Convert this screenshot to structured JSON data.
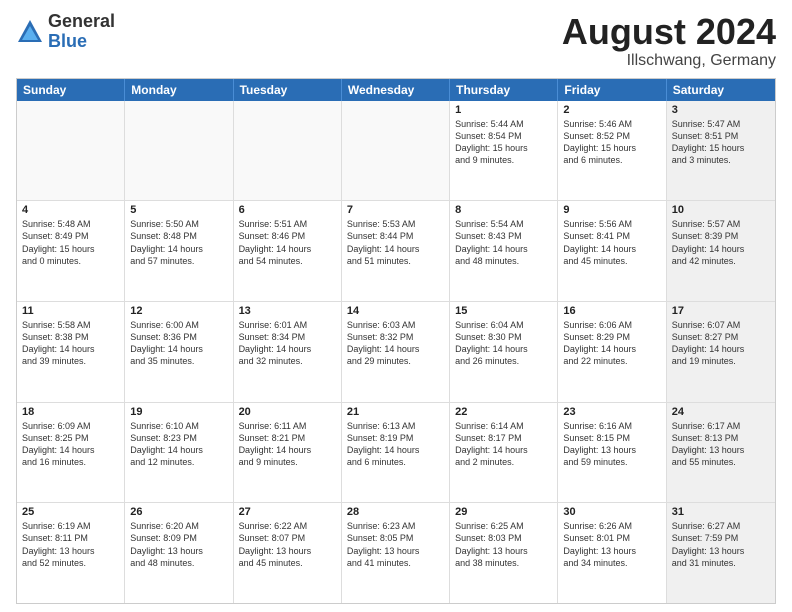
{
  "logo": {
    "general": "General",
    "blue": "Blue"
  },
  "title": {
    "month": "August 2024",
    "location": "Illschwang, Germany"
  },
  "calendar": {
    "headers": [
      "Sunday",
      "Monday",
      "Tuesday",
      "Wednesday",
      "Thursday",
      "Friday",
      "Saturday"
    ],
    "rows": [
      [
        {
          "day": "",
          "empty": true
        },
        {
          "day": "",
          "empty": true
        },
        {
          "day": "",
          "empty": true
        },
        {
          "day": "",
          "empty": true
        },
        {
          "day": "1",
          "info": "Sunrise: 5:44 AM\nSunset: 8:54 PM\nDaylight: 15 hours\nand 9 minutes."
        },
        {
          "day": "2",
          "info": "Sunrise: 5:46 AM\nSunset: 8:52 PM\nDaylight: 15 hours\nand 6 minutes."
        },
        {
          "day": "3",
          "info": "Sunrise: 5:47 AM\nSunset: 8:51 PM\nDaylight: 15 hours\nand 3 minutes.",
          "shaded": true
        }
      ],
      [
        {
          "day": "4",
          "info": "Sunrise: 5:48 AM\nSunset: 8:49 PM\nDaylight: 15 hours\nand 0 minutes."
        },
        {
          "day": "5",
          "info": "Sunrise: 5:50 AM\nSunset: 8:48 PM\nDaylight: 14 hours\nand 57 minutes."
        },
        {
          "day": "6",
          "info": "Sunrise: 5:51 AM\nSunset: 8:46 PM\nDaylight: 14 hours\nand 54 minutes."
        },
        {
          "day": "7",
          "info": "Sunrise: 5:53 AM\nSunset: 8:44 PM\nDaylight: 14 hours\nand 51 minutes."
        },
        {
          "day": "8",
          "info": "Sunrise: 5:54 AM\nSunset: 8:43 PM\nDaylight: 14 hours\nand 48 minutes."
        },
        {
          "day": "9",
          "info": "Sunrise: 5:56 AM\nSunset: 8:41 PM\nDaylight: 14 hours\nand 45 minutes."
        },
        {
          "day": "10",
          "info": "Sunrise: 5:57 AM\nSunset: 8:39 PM\nDaylight: 14 hours\nand 42 minutes.",
          "shaded": true
        }
      ],
      [
        {
          "day": "11",
          "info": "Sunrise: 5:58 AM\nSunset: 8:38 PM\nDaylight: 14 hours\nand 39 minutes."
        },
        {
          "day": "12",
          "info": "Sunrise: 6:00 AM\nSunset: 8:36 PM\nDaylight: 14 hours\nand 35 minutes."
        },
        {
          "day": "13",
          "info": "Sunrise: 6:01 AM\nSunset: 8:34 PM\nDaylight: 14 hours\nand 32 minutes."
        },
        {
          "day": "14",
          "info": "Sunrise: 6:03 AM\nSunset: 8:32 PM\nDaylight: 14 hours\nand 29 minutes."
        },
        {
          "day": "15",
          "info": "Sunrise: 6:04 AM\nSunset: 8:30 PM\nDaylight: 14 hours\nand 26 minutes."
        },
        {
          "day": "16",
          "info": "Sunrise: 6:06 AM\nSunset: 8:29 PM\nDaylight: 14 hours\nand 22 minutes."
        },
        {
          "day": "17",
          "info": "Sunrise: 6:07 AM\nSunset: 8:27 PM\nDaylight: 14 hours\nand 19 minutes.",
          "shaded": true
        }
      ],
      [
        {
          "day": "18",
          "info": "Sunrise: 6:09 AM\nSunset: 8:25 PM\nDaylight: 14 hours\nand 16 minutes."
        },
        {
          "day": "19",
          "info": "Sunrise: 6:10 AM\nSunset: 8:23 PM\nDaylight: 14 hours\nand 12 minutes."
        },
        {
          "day": "20",
          "info": "Sunrise: 6:11 AM\nSunset: 8:21 PM\nDaylight: 14 hours\nand 9 minutes."
        },
        {
          "day": "21",
          "info": "Sunrise: 6:13 AM\nSunset: 8:19 PM\nDaylight: 14 hours\nand 6 minutes."
        },
        {
          "day": "22",
          "info": "Sunrise: 6:14 AM\nSunset: 8:17 PM\nDaylight: 14 hours\nand 2 minutes."
        },
        {
          "day": "23",
          "info": "Sunrise: 6:16 AM\nSunset: 8:15 PM\nDaylight: 13 hours\nand 59 minutes."
        },
        {
          "day": "24",
          "info": "Sunrise: 6:17 AM\nSunset: 8:13 PM\nDaylight: 13 hours\nand 55 minutes.",
          "shaded": true
        }
      ],
      [
        {
          "day": "25",
          "info": "Sunrise: 6:19 AM\nSunset: 8:11 PM\nDaylight: 13 hours\nand 52 minutes."
        },
        {
          "day": "26",
          "info": "Sunrise: 6:20 AM\nSunset: 8:09 PM\nDaylight: 13 hours\nand 48 minutes."
        },
        {
          "day": "27",
          "info": "Sunrise: 6:22 AM\nSunset: 8:07 PM\nDaylight: 13 hours\nand 45 minutes."
        },
        {
          "day": "28",
          "info": "Sunrise: 6:23 AM\nSunset: 8:05 PM\nDaylight: 13 hours\nand 41 minutes."
        },
        {
          "day": "29",
          "info": "Sunrise: 6:25 AM\nSunset: 8:03 PM\nDaylight: 13 hours\nand 38 minutes."
        },
        {
          "day": "30",
          "info": "Sunrise: 6:26 AM\nSunset: 8:01 PM\nDaylight: 13 hours\nand 34 minutes."
        },
        {
          "day": "31",
          "info": "Sunrise: 6:27 AM\nSunset: 7:59 PM\nDaylight: 13 hours\nand 31 minutes.",
          "shaded": true
        }
      ]
    ]
  }
}
